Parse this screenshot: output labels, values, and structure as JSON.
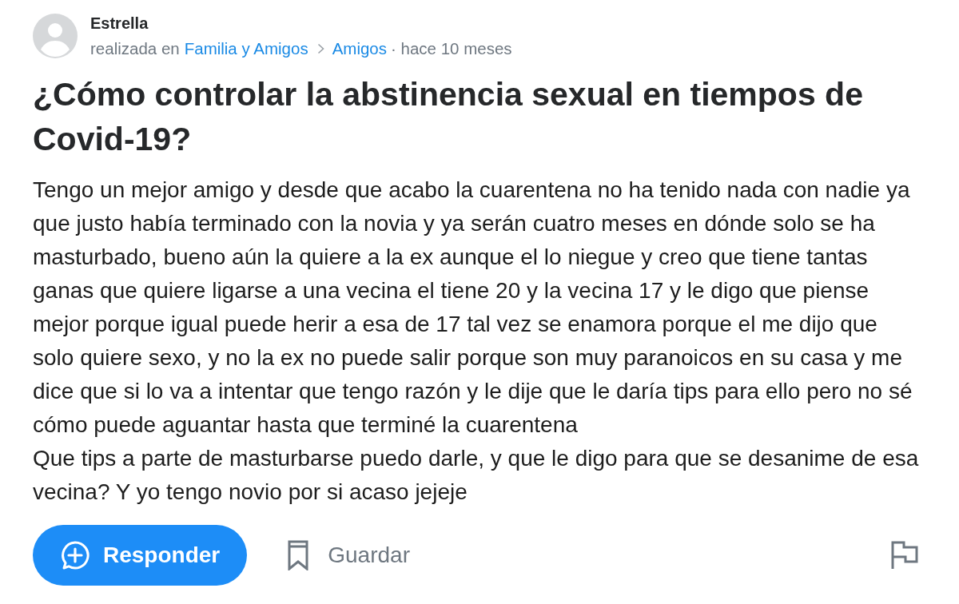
{
  "author": {
    "name": "Estrella",
    "prefix": "realizada en",
    "category": "Familia y Amigos",
    "subcategory": "Amigos",
    "time": "· hace 10 meses"
  },
  "question": {
    "title": "¿Cómo controlar la abstinencia sexual en tiempos de Covid-19?",
    "body": [
      "Tengo un mejor amigo y desde que acabo la cuarentena no ha tenido nada con nadie ya que justo había terminado con la novia y ya serán cuatro meses en dónde solo se ha masturbado, bueno aún la quiere a la ex aunque el lo niegue y creo que tiene tantas ganas que quiere ligarse a una vecina el tiene 20 y la vecina 17 y le digo que piense mejor porque igual puede herir a esa de 17 tal vez se enamora porque el me dijo que solo quiere sexo, y no la ex no puede salir porque son muy paranoicos en su casa y me dice que si lo va a intentar que tengo razón y le dije que le daría tips para ello pero no sé cómo puede aguantar hasta que terminé la cuarentena",
      "Que tips a parte de masturbarse puedo darle, y que le digo para que se desanime de esa vecina? Y yo tengo novio por si acaso jejeje"
    ]
  },
  "actions": [
    {
      "kind": "answer",
      "label": "Responder"
    },
    {
      "kind": "save",
      "label": "Guardar"
    },
    {
      "kind": "report"
    }
  ]
}
